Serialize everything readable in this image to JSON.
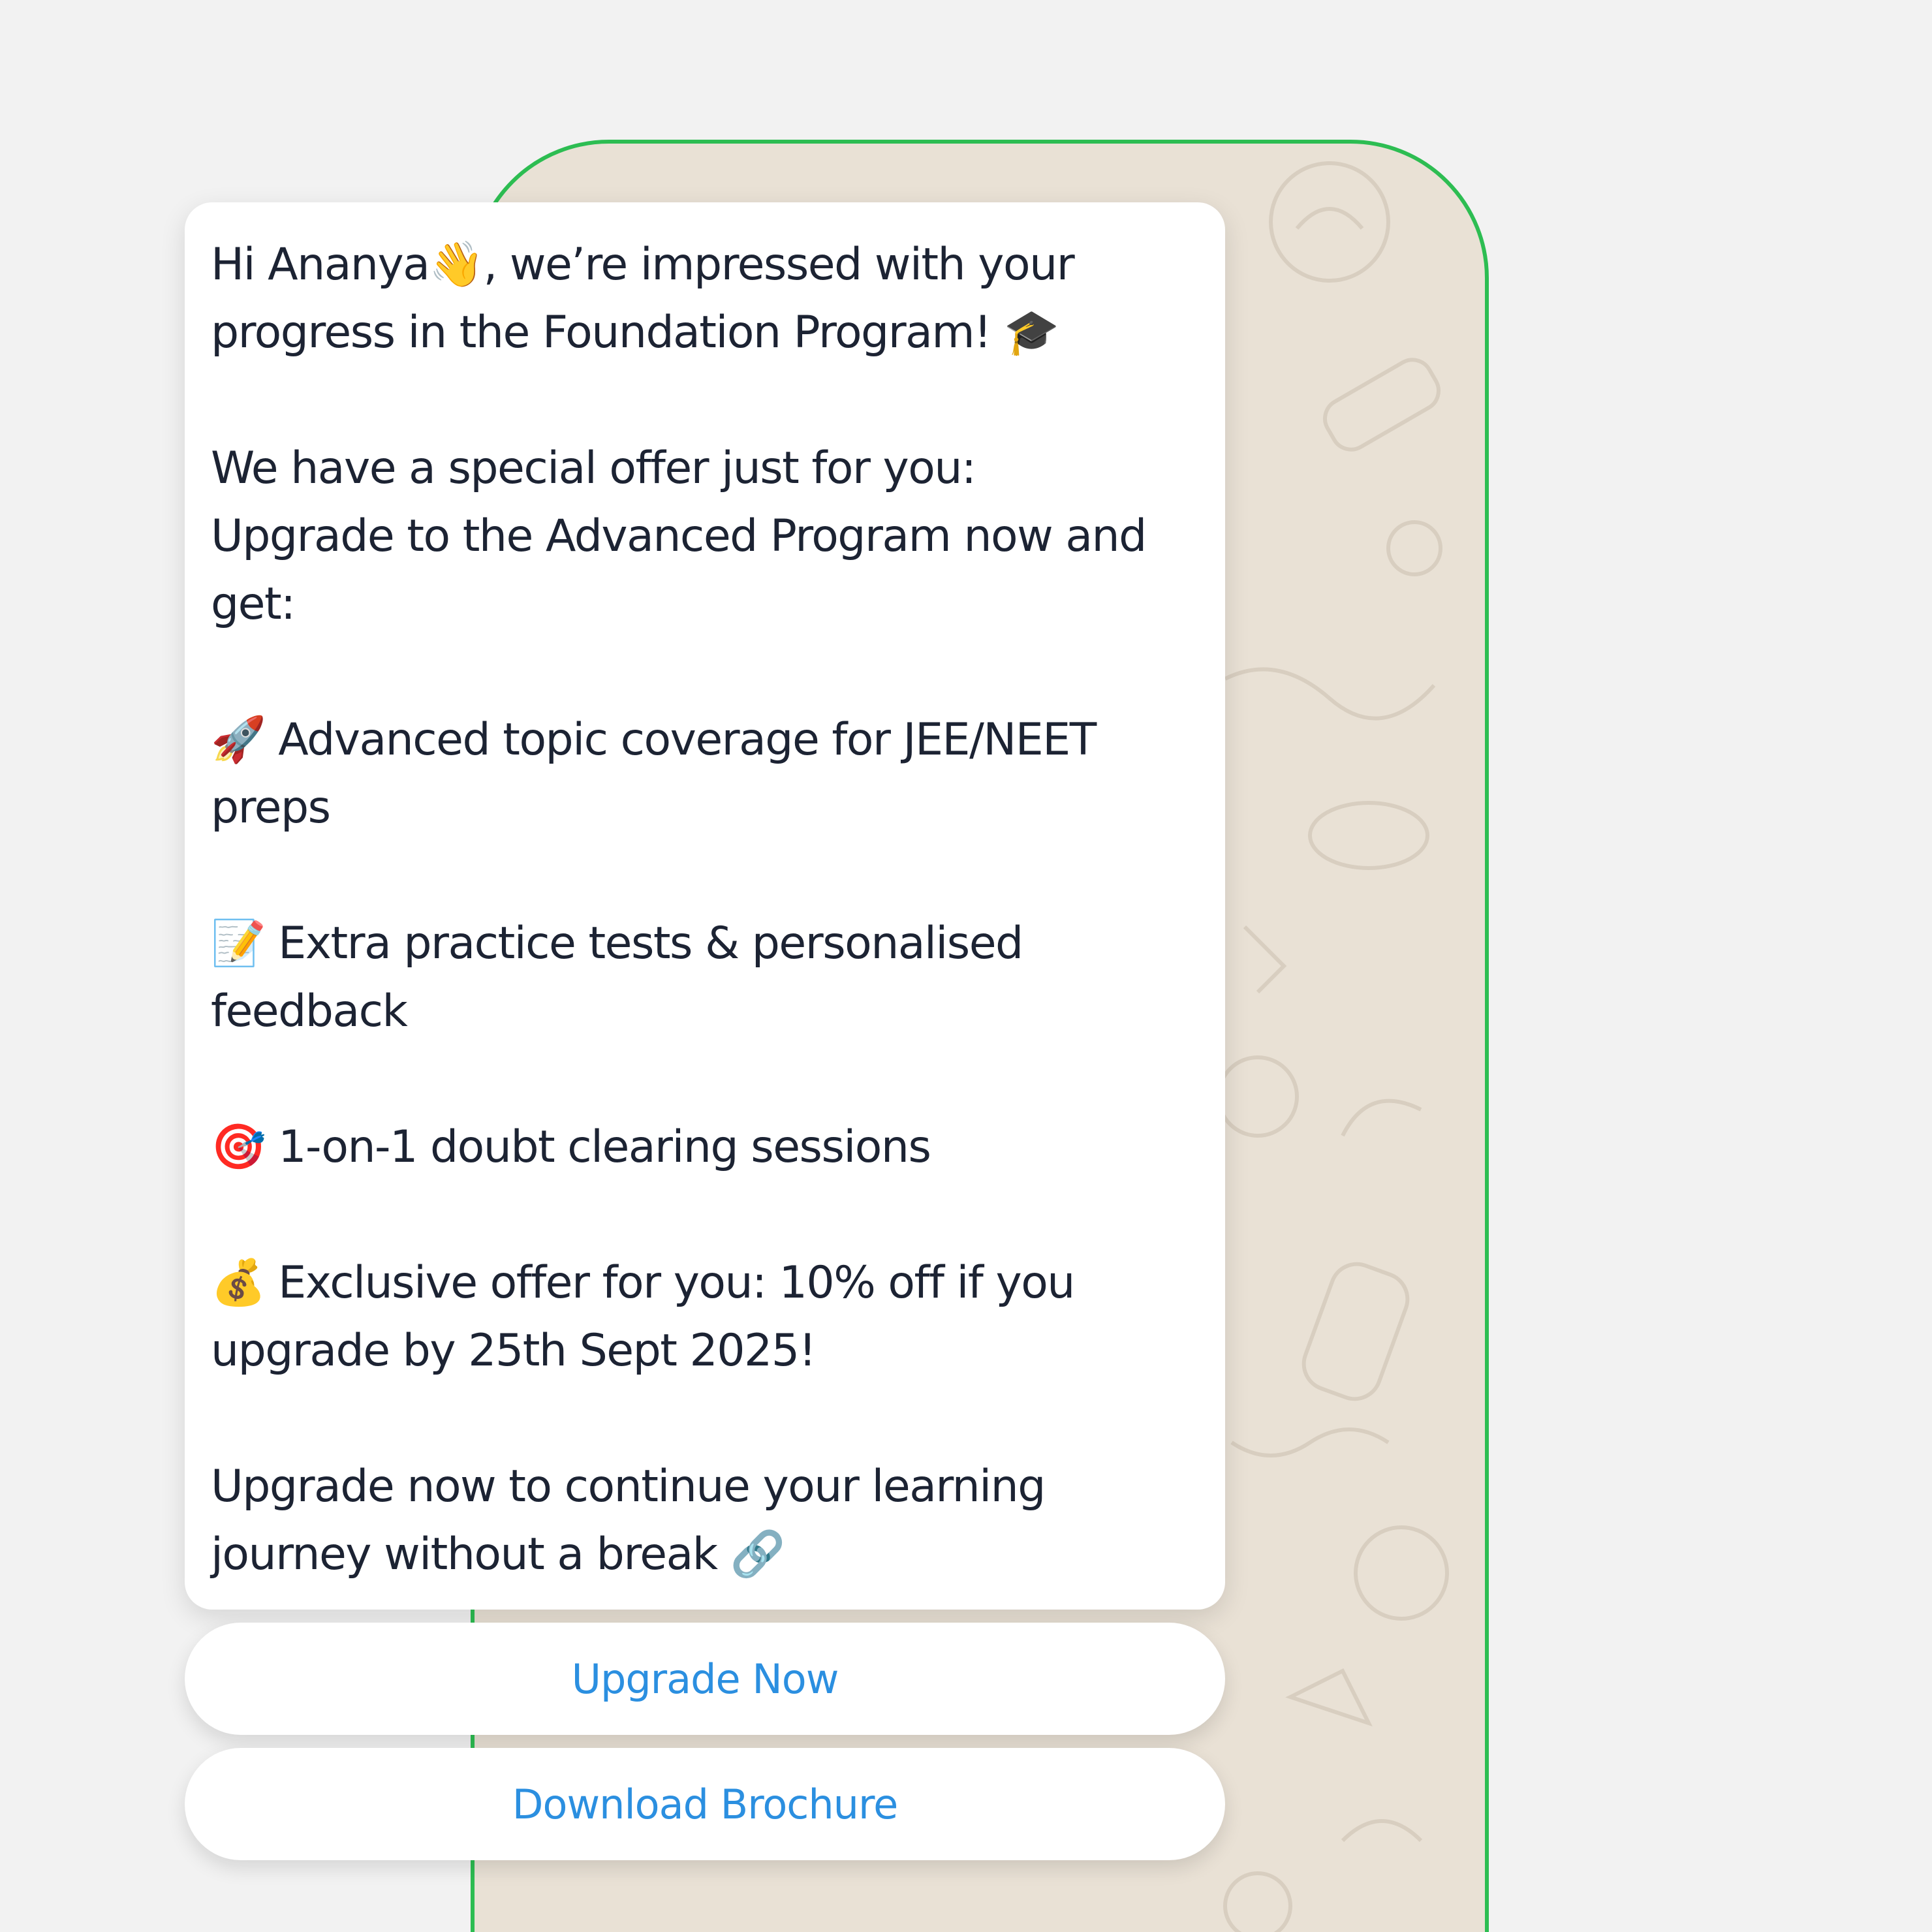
{
  "colors": {
    "page_background": "#f2f2f2",
    "phone_border": "#2dbd52",
    "chat_wallpaper": "#e9e1d5",
    "bubble_background": "#ffffff",
    "message_text": "#1c2333",
    "button_text": "#2b8fe0"
  },
  "message": {
    "greeting_line1": "Hi Ananya👋, we’re impressed with your",
    "greeting_line2": "progress in the Foundation Program! 🎓",
    "offer_line1": "We have a special offer just for you:",
    "offer_line2": "Upgrade to the Advanced Program now and",
    "offer_line3": "get:",
    "benefit1_line1": "🚀 Advanced topic coverage for JEE/NEET",
    "benefit1_line2": "preps",
    "benefit2_line1": "📝 Extra practice tests & personalised",
    "benefit2_line2": "feedback",
    "benefit3_line1": "🎯 1-on-1 doubt clearing sessions",
    "benefit4_line1": "💰 Exclusive offer for you: 10% off if you",
    "benefit4_line2": "upgrade by 25th Sept 2025!",
    "closing_line1": "Upgrade now to continue your learning",
    "closing_line2": "journey without a break 🔗"
  },
  "buttons": {
    "upgrade_label": "Upgrade Now",
    "brochure_label": "Download Brochure"
  }
}
